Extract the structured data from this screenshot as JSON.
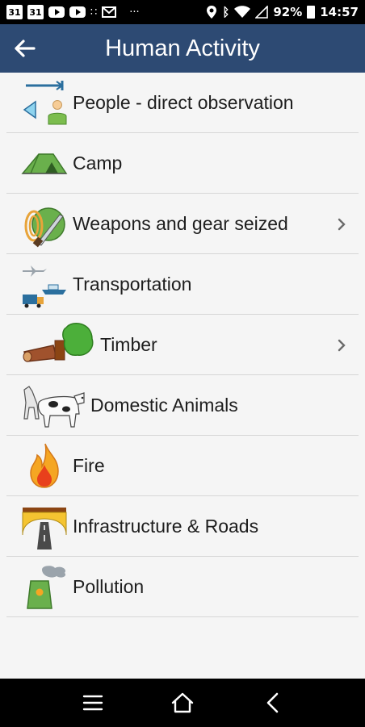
{
  "status_bar": {
    "cal_day_1": "31",
    "cal_day_2": "31",
    "more_dots": "···",
    "battery_percent": "92%",
    "time": "14:57"
  },
  "app_bar": {
    "title": "Human Activity"
  },
  "list": {
    "items": [
      {
        "label": "People - direct observation",
        "icon": "people-observation-icon",
        "has_chevron": false
      },
      {
        "label": "Camp",
        "icon": "camp-tent-icon",
        "has_chevron": false
      },
      {
        "label": "Weapons and gear seized",
        "icon": "weapons-gear-icon",
        "has_chevron": true
      },
      {
        "label": "Transportation",
        "icon": "transportation-icon",
        "has_chevron": false
      },
      {
        "label": "Timber",
        "icon": "timber-icon",
        "has_chevron": true
      },
      {
        "label": "Domestic Animals",
        "icon": "domestic-animals-icon",
        "has_chevron": false
      },
      {
        "label": "Fire",
        "icon": "fire-icon",
        "has_chevron": false
      },
      {
        "label": "Infrastructure & Roads",
        "icon": "infrastructure-roads-icon",
        "has_chevron": false
      },
      {
        "label": "Pollution",
        "icon": "pollution-icon",
        "has_chevron": false
      }
    ]
  },
  "colors": {
    "app_bar": "#2d4a73",
    "background": "#f5f5f5",
    "divider": "#d6d6d6",
    "text": "#1e1e1e"
  }
}
